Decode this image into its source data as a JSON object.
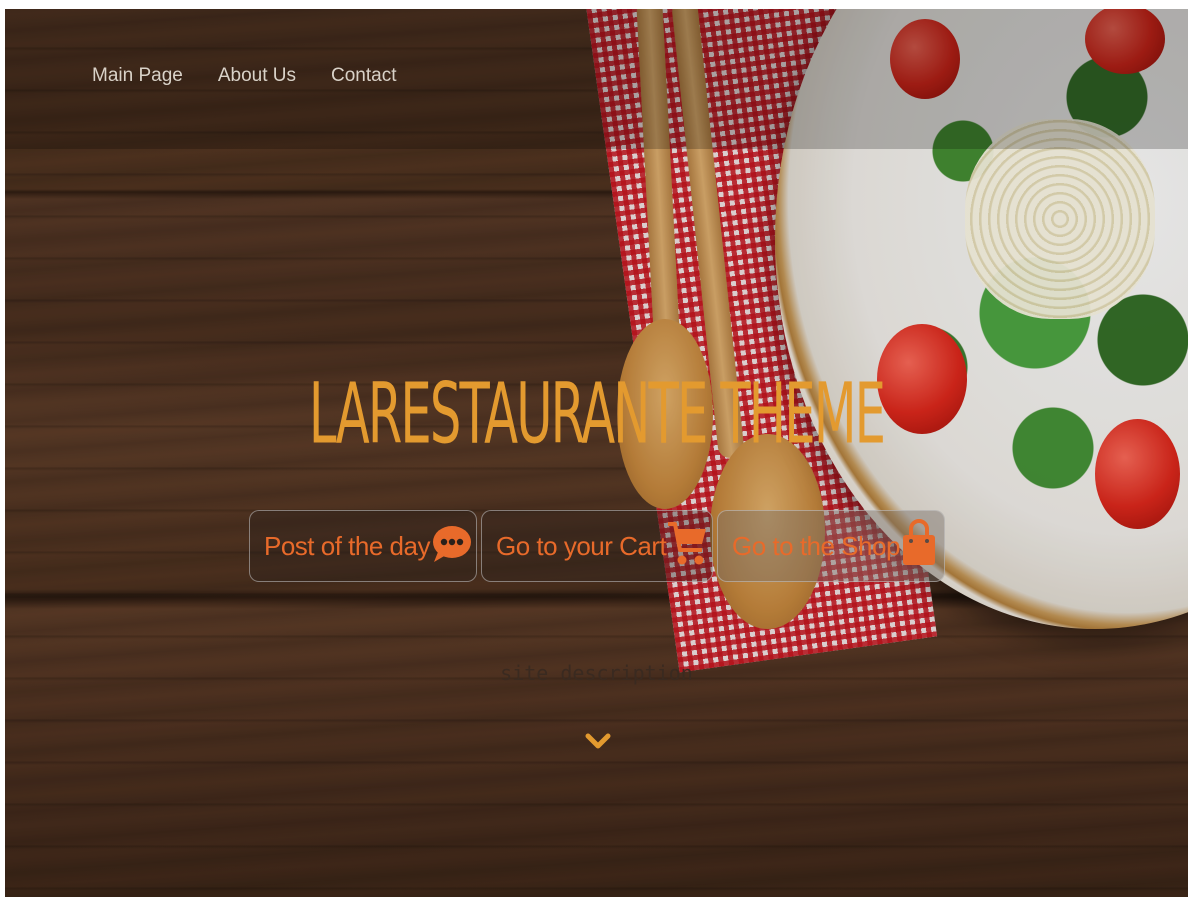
{
  "nav": {
    "items": [
      {
        "label": "Main Page"
      },
      {
        "label": "About Us"
      },
      {
        "label": "Contact"
      }
    ]
  },
  "hero": {
    "title": "LaRestaurante Theme",
    "description": "site description",
    "buttons": [
      {
        "label": "Post of the day",
        "icon": "chat-bubble-icon"
      },
      {
        "label": "Go to your Cart",
        "icon": "shopping-cart-icon"
      },
      {
        "label": "Go to the Shop",
        "icon": "shopping-bag-icon"
      }
    ],
    "scroll_icon": "chevron-down-icon"
  },
  "colors": {
    "accent_orange": "#e86a2a",
    "title_gold": "#e39a2f",
    "nav_text": "#d9d2c8",
    "background_wood": "#4a2f1f"
  }
}
